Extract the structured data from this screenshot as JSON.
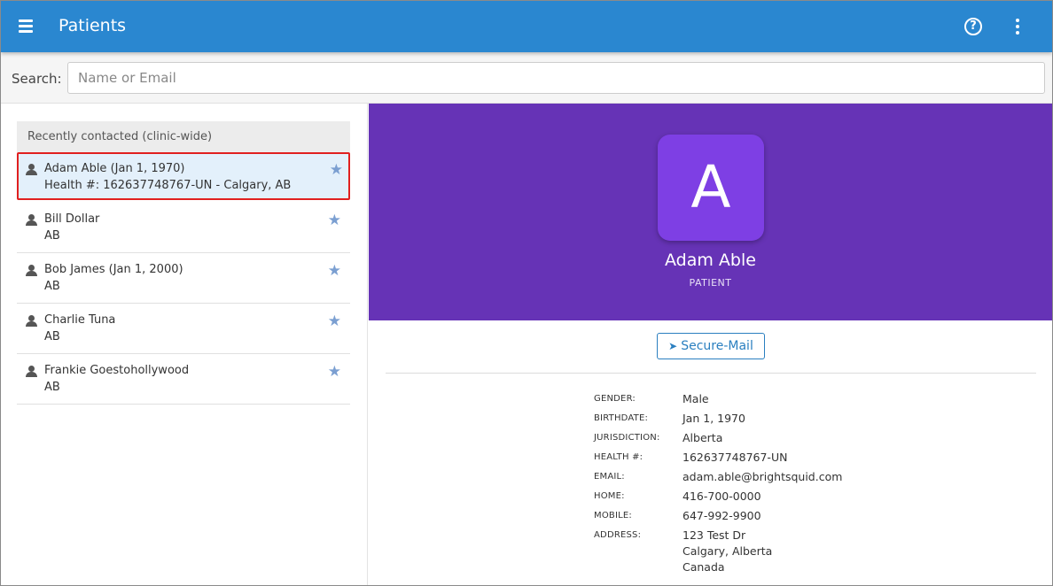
{
  "header": {
    "title": "Patients",
    "menu_icon": "hamburger-menu-icon",
    "help_icon": "help-circle-icon",
    "help_glyph": "?",
    "more_icon": "more-vertical-icon"
  },
  "search": {
    "label": "Search:",
    "placeholder": "Name or Email",
    "value": ""
  },
  "list": {
    "header": "Recently contacted (clinic-wide)",
    "items": [
      {
        "name": "Adam Able (Jan 1, 1970)",
        "sub": "Health #: 162637748767-UN - Calgary, AB",
        "selected": true
      },
      {
        "name": "Bill Dollar",
        "sub": "AB",
        "selected": false
      },
      {
        "name": "Bob James (Jan 1, 2000)",
        "sub": "AB",
        "selected": false
      },
      {
        "name": "Charlie Tuna",
        "sub": "AB",
        "selected": false
      },
      {
        "name": "Frankie Goestohollywood",
        "sub": "AB",
        "selected": false
      }
    ],
    "star_glyph": "★"
  },
  "profile": {
    "initial": "A",
    "name": "Adam Able",
    "role": "PATIENT",
    "avatar_color": "#7e3fe4",
    "banner_color": "#6633b6",
    "secure_mail_label": "Secure-Mail",
    "secure_mail_icon": "send-icon",
    "details": [
      {
        "label": "GENDER:",
        "value": "Male"
      },
      {
        "label": "BIRTHDATE:",
        "value": "Jan 1, 1970"
      },
      {
        "label": "JURISDICTION:",
        "value": "Alberta"
      },
      {
        "label": "HEALTH #:",
        "value": "162637748767-UN"
      },
      {
        "label": "EMAIL:",
        "value": "adam.able@brightsquid.com"
      },
      {
        "label": "HOME:",
        "value": "416-700-0000"
      },
      {
        "label": "MOBILE:",
        "value": "647-992-9900"
      },
      {
        "label": "ADDRESS:",
        "value_lines": [
          "123 Test Dr",
          "Calgary, Alberta",
          "Canada"
        ]
      }
    ]
  },
  "colors": {
    "topbar": "#2a87d0",
    "selection_border": "#e02020",
    "selection_bg": "#e3f0fb",
    "star": "#7b9fd1",
    "link": "#2a7fc0"
  }
}
